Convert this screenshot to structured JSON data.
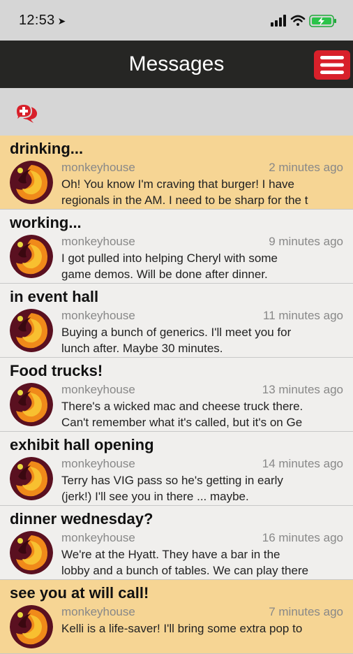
{
  "status": {
    "time": "12:53",
    "location_icon": "location-arrow-icon",
    "icons": [
      "signal-icon",
      "wifi-icon",
      "battery-icon"
    ]
  },
  "header": {
    "title": "Messages",
    "menu_icon": "hamburger-menu-icon"
  },
  "toolbar": {
    "compose_icon": "new-message-icon"
  },
  "colors": {
    "header_bg": "#262624",
    "accent_red": "#d8202a",
    "highlight_bg": "#f6d594",
    "item_bg": "#f0efed"
  },
  "messages": [
    {
      "title": "drinking...",
      "user": "monkeyhouse",
      "time": "2 minutes ago",
      "body": "Oh! You know I'm craving that burger! I have\nregionals in the AM. I need to be sharp for the t",
      "unread": true
    },
    {
      "title": "working...",
      "user": "monkeyhouse",
      "time": "9 minutes ago",
      "body": "I got pulled into helping Cheryl with some\ngame demos. Will be done after dinner.",
      "unread": false
    },
    {
      "title": "in event hall",
      "user": "monkeyhouse",
      "time": "11 minutes ago",
      "body": "Buying a bunch of generics. I'll meet you for\nlunch after. Maybe 30 minutes.",
      "unread": false
    },
    {
      "title": "Food trucks!",
      "user": "monkeyhouse",
      "time": "13 minutes ago",
      "body": "There's a wicked mac and cheese truck there.\nCan't remember what it's called, but it's on Ge",
      "unread": false
    },
    {
      "title": "exhibit hall opening",
      "user": "monkeyhouse",
      "time": "14 minutes ago",
      "body": "Terry has VIG pass so he's getting in early\n(jerk!) I'll see you in there ... maybe.",
      "unread": false
    },
    {
      "title": "dinner wednesday?",
      "user": "monkeyhouse",
      "time": "16 minutes ago",
      "body": "We're at the Hyatt. They have a bar in the\nlobby and a bunch of tables. We can play there",
      "unread": false
    },
    {
      "title": "see you at will call!",
      "user": "monkeyhouse",
      "time": "7 minutes ago",
      "body": "Kelli is a life-saver! I'll bring some extra pop to\n",
      "unread": true
    }
  ]
}
